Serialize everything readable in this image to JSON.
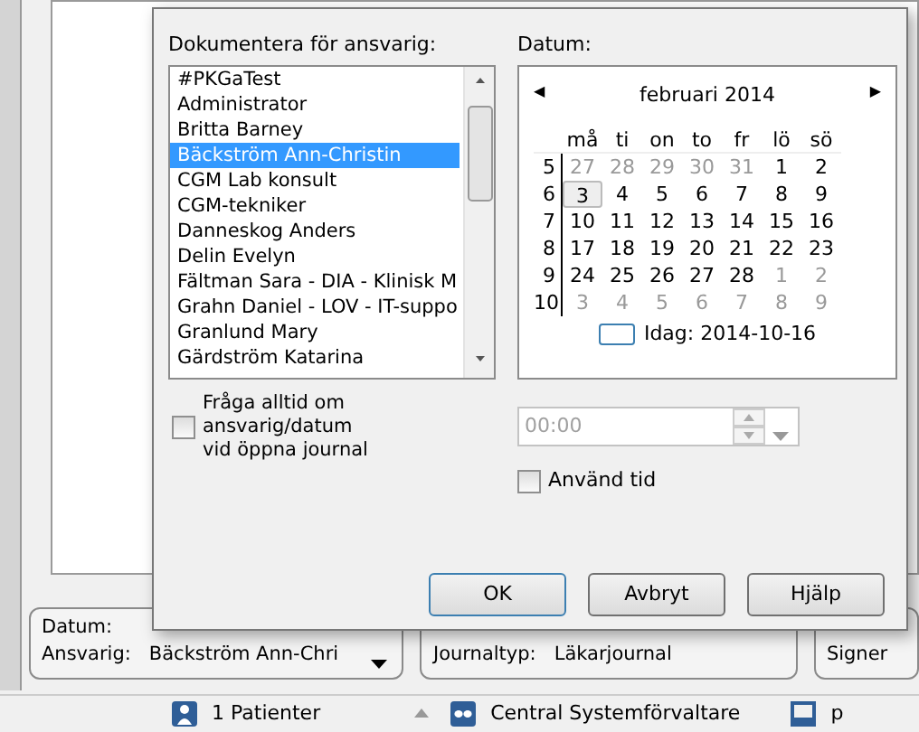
{
  "dialog": {
    "responsible_label": "Dokumentera för ansvarig:",
    "responsible_list": [
      {
        "text": "#PKGaTest",
        "selected": false
      },
      {
        "text": "Administrator",
        "selected": false
      },
      {
        "text": "Britta Barney",
        "selected": false
      },
      {
        "text": "Bäckström Ann-Christin",
        "selected": true
      },
      {
        "text": "CGM Lab konsult",
        "selected": false
      },
      {
        "text": "CGM-tekniker",
        "selected": false
      },
      {
        "text": "Danneskog Anders",
        "selected": false
      },
      {
        "text": "Delin Evelyn",
        "selected": false
      },
      {
        "text": "Fältman Sara - DIA - Klinisk M",
        "selected": false
      },
      {
        "text": "Grahn Daniel - LOV - IT-suppo",
        "selected": false
      },
      {
        "text": "Granlund Mary",
        "selected": false
      },
      {
        "text": "Gärdström Katarina",
        "selected": false
      }
    ],
    "date_label": "Datum:",
    "calendar": {
      "prev": "◀",
      "month": "februari 2014",
      "next": "▶",
      "weekdays": [
        "må",
        "ti",
        "on",
        "to",
        "fr",
        "lö",
        "sö"
      ],
      "weeks": [
        {
          "week": "5",
          "days": [
            {
              "day": "27",
              "other_month": true,
              "selected": false
            },
            {
              "day": "28",
              "other_month": true,
              "selected": false
            },
            {
              "day": "29",
              "other_month": true,
              "selected": false
            },
            {
              "day": "30",
              "other_month": true,
              "selected": false
            },
            {
              "day": "31",
              "other_month": true,
              "selected": false
            },
            {
              "day": "1",
              "other_month": false,
              "selected": false
            },
            {
              "day": "2",
              "other_month": false,
              "selected": false
            }
          ]
        },
        {
          "week": "6",
          "days": [
            {
              "day": "3",
              "other_month": false,
              "selected": true
            },
            {
              "day": "4",
              "other_month": false,
              "selected": false
            },
            {
              "day": "5",
              "other_month": false,
              "selected": false
            },
            {
              "day": "6",
              "other_month": false,
              "selected": false
            },
            {
              "day": "7",
              "other_month": false,
              "selected": false
            },
            {
              "day": "8",
              "other_month": false,
              "selected": false
            },
            {
              "day": "9",
              "other_month": false,
              "selected": false
            }
          ]
        },
        {
          "week": "7",
          "days": [
            {
              "day": "10",
              "other_month": false,
              "selected": false
            },
            {
              "day": "11",
              "other_month": false,
              "selected": false
            },
            {
              "day": "12",
              "other_month": false,
              "selected": false
            },
            {
              "day": "13",
              "other_month": false,
              "selected": false
            },
            {
              "day": "14",
              "other_month": false,
              "selected": false
            },
            {
              "day": "15",
              "other_month": false,
              "selected": false
            },
            {
              "day": "16",
              "other_month": false,
              "selected": false
            }
          ]
        },
        {
          "week": "8",
          "days": [
            {
              "day": "17",
              "other_month": false,
              "selected": false
            },
            {
              "day": "18",
              "other_month": false,
              "selected": false
            },
            {
              "day": "19",
              "other_month": false,
              "selected": false
            },
            {
              "day": "20",
              "other_month": false,
              "selected": false
            },
            {
              "day": "21",
              "other_month": false,
              "selected": false
            },
            {
              "day": "22",
              "other_month": false,
              "selected": false
            },
            {
              "day": "23",
              "other_month": false,
              "selected": false
            }
          ]
        },
        {
          "week": "9",
          "days": [
            {
              "day": "24",
              "other_month": false,
              "selected": false
            },
            {
              "day": "25",
              "other_month": false,
              "selected": false
            },
            {
              "day": "26",
              "other_month": false,
              "selected": false
            },
            {
              "day": "27",
              "other_month": false,
              "selected": false
            },
            {
              "day": "28",
              "other_month": false,
              "selected": false
            },
            {
              "day": "1",
              "other_month": true,
              "selected": false
            },
            {
              "day": "2",
              "other_month": true,
              "selected": false
            }
          ]
        },
        {
          "week": "10",
          "days": [
            {
              "day": "3",
              "other_month": true,
              "selected": false
            },
            {
              "day": "4",
              "other_month": true,
              "selected": false
            },
            {
              "day": "5",
              "other_month": true,
              "selected": false
            },
            {
              "day": "6",
              "other_month": true,
              "selected": false
            },
            {
              "day": "7",
              "other_month": true,
              "selected": false
            },
            {
              "day": "8",
              "other_month": true,
              "selected": false
            },
            {
              "day": "9",
              "other_month": true,
              "selected": false
            }
          ]
        }
      ],
      "today": "Idag: 2014-10-16"
    },
    "ask_checkbox": {
      "label": "Fråga alltid om ansvarig/datum vid öppna journal",
      "checked": false
    },
    "time_field": {
      "value": "00:00",
      "disabled": true
    },
    "use_time_checkbox": {
      "label": "Använd tid",
      "checked": false
    },
    "buttons": [
      "OK",
      "Avbryt",
      "Hjälp"
    ]
  },
  "info_groups": [
    {
      "rows": [
        {
          "label": "Datum:",
          "value": ""
        },
        {
          "label": "Ansvarig:",
          "value": "Bäckström Ann-Chri"
        }
      ]
    },
    {
      "rows": [
        {
          "label": "Journaltyp:",
          "value": "Läkarjournal"
        }
      ]
    },
    {
      "rows": [
        {
          "label": "Signer",
          "value": ""
        }
      ]
    }
  ],
  "status_bar": [
    {
      "kind": "person",
      "text": "1 Patienter"
    },
    {
      "kind": "mask",
      "text": "Central Systemförvaltare"
    },
    {
      "kind": "monitor",
      "text": "p"
    }
  ]
}
